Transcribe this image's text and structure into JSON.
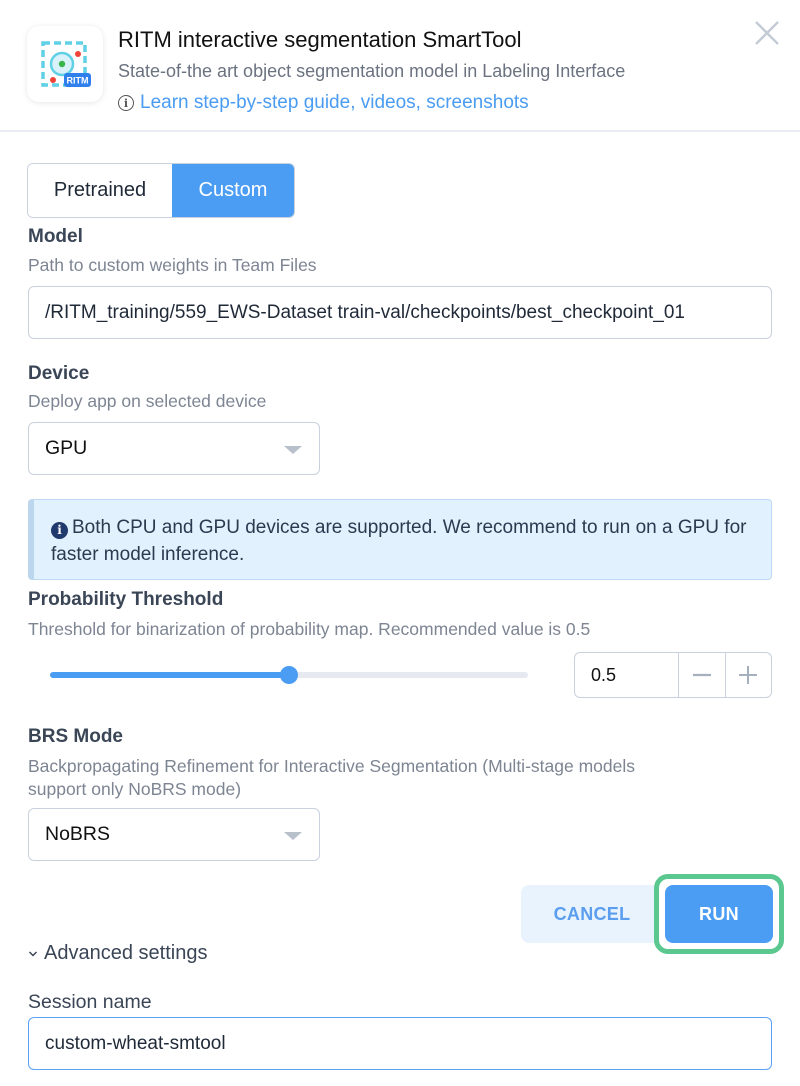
{
  "header": {
    "app_icon_badge": "RITM",
    "title": "RITM interactive segmentation SmartTool",
    "subtitle": "State-of-the art object segmentation model in Labeling Interface",
    "learn_link": "Learn step-by-step guide, videos, screenshots"
  },
  "model_source": {
    "options": [
      "Pretrained",
      "Custom"
    ],
    "selected": "Custom"
  },
  "model": {
    "label": "Model",
    "description": "Path to custom weights in Team Files",
    "value": "/RITM_training/559_EWS-Dataset train-val/checkpoints/best_checkpoint_01"
  },
  "device": {
    "label": "Device",
    "description": "Deploy app on selected device",
    "selected": "GPU"
  },
  "alert": {
    "text": "Both CPU and GPU devices are supported. We recommend to run on a GPU for faster model inference."
  },
  "threshold": {
    "label": "Probability Threshold",
    "description": "Threshold for binarization of probability map. Recommended value is 0.5",
    "value": 0.5,
    "value_text": "0.5",
    "min": 0,
    "max": 1
  },
  "brs": {
    "label": "BRS Mode",
    "description_line1": "Backpropagating Refinement for Interactive Segmentation (Multi-stage models",
    "description_line2": "support only NoBRS mode)",
    "selected": "NoBRS"
  },
  "actions": {
    "cancel_label": "CANCEL",
    "run_label": "RUN"
  },
  "advanced": {
    "label": "Advanced settings",
    "session_label": "Session name",
    "session_value": "custom-wheat-smtool"
  },
  "colors": {
    "accent": "#4b9df3",
    "highlight_outline": "#5bc98f",
    "alert_bg": "#e1f1fd"
  }
}
